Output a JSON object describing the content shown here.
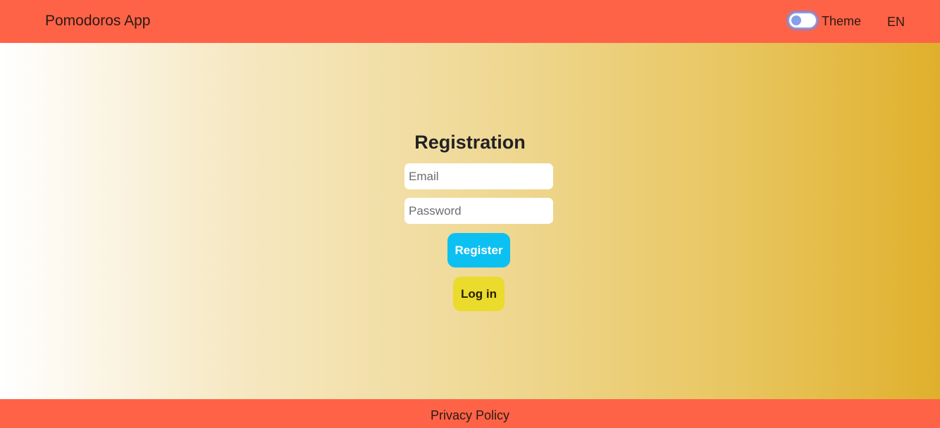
{
  "navbar": {
    "brand": "Pomodoros App",
    "theme_label": "Theme",
    "language": "EN",
    "theme_toggle_on": false
  },
  "registration": {
    "title": "Registration",
    "email_placeholder": "Email",
    "email_value": "",
    "password_placeholder": "Password",
    "password_value": "",
    "register_label": "Register",
    "login_label": "Log in"
  },
  "footer": {
    "privacy_label": "Privacy Policy"
  },
  "colors": {
    "header_footer_bg": "#ff6347",
    "register_button": "#0dc0f2",
    "login_button": "#eadb2c",
    "gradient_start": "#ffffff",
    "gradient_end": "#e0b02c",
    "toggle_accent": "#86a0e8"
  }
}
